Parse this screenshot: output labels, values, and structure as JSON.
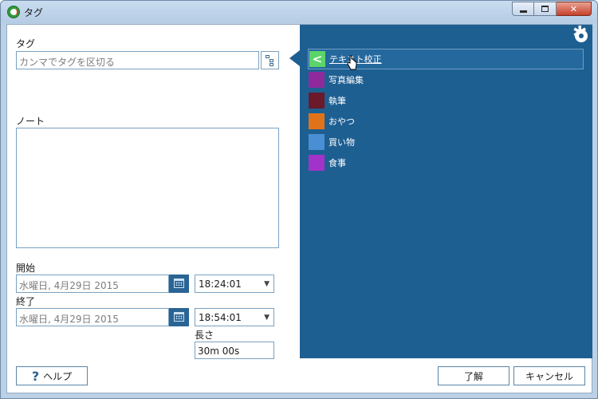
{
  "window": {
    "title": "タグ"
  },
  "form": {
    "tags_label": "タグ",
    "tags_placeholder": "カンマでタグを区切る",
    "notes_label": "ノート",
    "start_label": "開始",
    "start_date": "水曜日, 4月29日 2015",
    "start_time": "18:24:01",
    "end_label": "終了",
    "end_date": "水曜日, 4月29日 2015",
    "end_time": "18:54:01",
    "duration_label": "長さ",
    "duration_value": "30m 00s"
  },
  "buttons": {
    "help": "ヘルプ",
    "ok": "了解",
    "cancel": "キャンセル"
  },
  "tags": [
    {
      "label": "テキスト校正",
      "color": "#5bd46a",
      "selected": true
    },
    {
      "label": "写真編集",
      "color": "#8e2a9c",
      "selected": false
    },
    {
      "label": "執筆",
      "color": "#6a1a2a",
      "selected": false
    },
    {
      "label": "おやつ",
      "color": "#e0731a",
      "selected": false
    },
    {
      "label": "買い物",
      "color": "#4a8fd4",
      "selected": false
    },
    {
      "label": "食事",
      "color": "#a233c8",
      "selected": false
    }
  ],
  "icons": {
    "app": "app-logo-icon",
    "tag_tree": "tag-tree-icon",
    "calendar": "calendar-icon",
    "settings": "gear-icon",
    "back": "chevron-left-icon"
  }
}
